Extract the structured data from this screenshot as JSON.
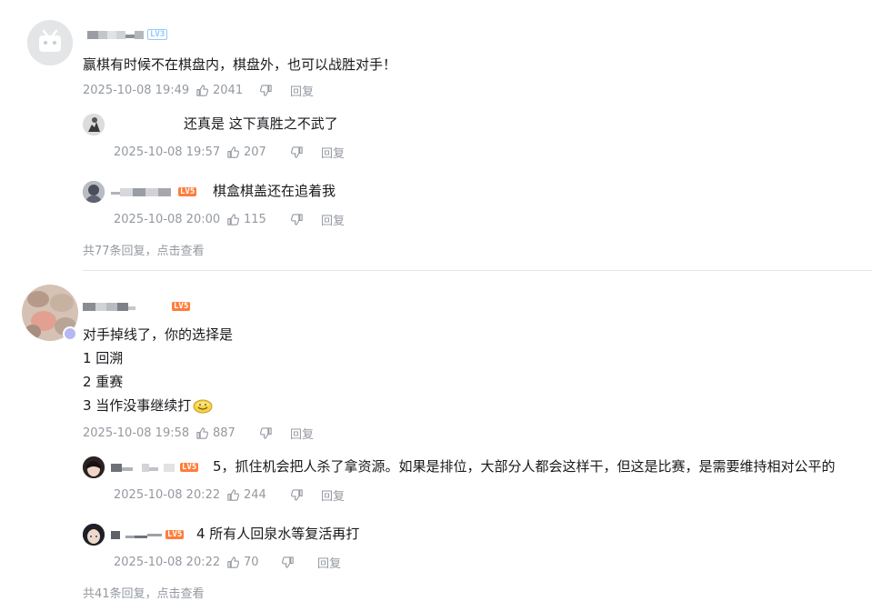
{
  "comments": [
    {
      "content": "赢棋有时候不在棋盘内，棋盘外，也可以战胜对手！",
      "level": "LV3",
      "time": "2025-10-08 19:49",
      "likes": "2041",
      "reply_label": "回复",
      "replies": [
        {
          "content": "还真是 这下真胜之不武了",
          "time": "2025-10-08 19:57",
          "likes": "207",
          "reply_label": "回复"
        },
        {
          "content": "棋盒棋盖还在追着我",
          "level": "LV5",
          "time": "2025-10-08 20:00",
          "likes": "115",
          "reply_label": "回复"
        }
      ],
      "more_text": "共77条回复，点击查看"
    },
    {
      "content_lines": [
        "对手掉线了，你的选择是",
        "1 回溯",
        "2 重赛",
        "3 当作没事继续打"
      ],
      "level": "LV5",
      "time": "2025-10-08 19:58",
      "likes": "887",
      "reply_label": "回复",
      "replies": [
        {
          "content": "5，抓住机会把人杀了拿资源。如果是排位，大部分人都会这样干，但这是比赛，是需要维持相对公平的",
          "level": "LV5",
          "time": "2025-10-08 20:22",
          "likes": "244",
          "reply_label": "回复"
        },
        {
          "content": "4 所有人回泉水等复活再打",
          "level": "LV5",
          "time": "2025-10-08 20:22",
          "likes": "70",
          "reply_label": "回复"
        }
      ],
      "more_text": "共41条回复，点击查看"
    }
  ],
  "colors": {
    "meta": "#9499a0",
    "text": "#18191c",
    "level_orange": "#ff7d3b",
    "level_blue": "#8fc9ff",
    "divider": "#e3e5e7"
  }
}
